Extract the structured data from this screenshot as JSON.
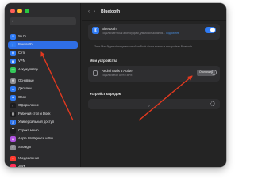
{
  "window": {
    "title": "Bluetooth",
    "nav": {
      "back": "‹",
      "forward": "›"
    }
  },
  "sidebar": {
    "search_icon": "search-icon",
    "items": [
      {
        "label": "Wi-Fi",
        "color": "#2f7bf5",
        "icon": "wifi-icon",
        "glyph": "≋",
        "active": false
      },
      {
        "label": "Bluetooth",
        "color": "#2f7bf5",
        "icon": "bluetooth-icon",
        "glyph": "ᛒ",
        "active": true
      },
      {
        "label": "Сеть",
        "color": "#2f7bf5",
        "icon": "globe-icon",
        "glyph": "◍",
        "active": false
      },
      {
        "label": "VPN",
        "color": "#2f7bf5",
        "icon": "vpn-icon",
        "glyph": "▣",
        "active": false
      },
      {
        "label": "Аккумулятор",
        "color": "#34c759",
        "icon": "battery-icon",
        "glyph": "▬",
        "active": false
      },
      {
        "label": "Основные",
        "color": "#8e8e93",
        "icon": "gear-icon",
        "glyph": "⚙",
        "active": false,
        "gap": true
      },
      {
        "label": "Дисплеи",
        "color": "#2f7bf5",
        "icon": "display-icon",
        "glyph": "▭",
        "active": false
      },
      {
        "label": "Обои",
        "color": "#2f7bf5",
        "icon": "wallpaper-icon",
        "glyph": "✿",
        "active": false
      },
      {
        "label": "Оформление",
        "color": "#1c1c1e",
        "icon": "appearance-icon",
        "glyph": "◐",
        "active": false
      },
      {
        "label": "Рабочий стол и Dock",
        "color": "#1c1c1e",
        "icon": "dock-icon",
        "glyph": "▤",
        "active": false
      },
      {
        "label": "Универсальный доступ",
        "color": "#2f7bf5",
        "icon": "accessibility-icon",
        "glyph": "♿",
        "active": false
      },
      {
        "label": "Строка меню",
        "color": "#1c1c1e",
        "icon": "menubar-icon",
        "glyph": "▔",
        "active": false
      },
      {
        "label": "Apple Intelligence и Siri",
        "color": "#af52de",
        "icon": "siri-icon",
        "glyph": "◉",
        "active": false
      },
      {
        "label": "Spotlight",
        "color": "#8e8e93",
        "icon": "spotlight-icon",
        "glyph": "⌕",
        "active": false
      },
      {
        "label": "Уведомления",
        "color": "#ff3b30",
        "icon": "notifications-icon",
        "glyph": "●",
        "active": false,
        "gap": true
      },
      {
        "label": "Звук",
        "color": "#ff2d55",
        "icon": "sound-icon",
        "glyph": "♪",
        "active": false
      }
    ]
  },
  "bluetooth": {
    "title": "Bluetooth",
    "desc_prefix": "Подключайтесь к аксессуарам для использования... ",
    "desc_link": "Подробнее",
    "toggle_on": true,
    "icon_glyph": "ᛒ",
    "discoverable": "Этот Mac будет обнаружен как «MacBook Air» и только в настройках Bluetooth"
  },
  "my_devices": {
    "title": "Мои устройства",
    "items": [
      {
        "name": "Redmi Buds 6 Active",
        "status": "Подключено  ▪ 80%  ▪ 80%",
        "button": "Отключить",
        "info_glyph": "i"
      }
    ]
  },
  "nearby": {
    "title": "Устройства рядом"
  },
  "help": {
    "label": "?"
  },
  "colors": {
    "accent": "#2f7bf5",
    "annotation_arrow": "#e2391f"
  }
}
